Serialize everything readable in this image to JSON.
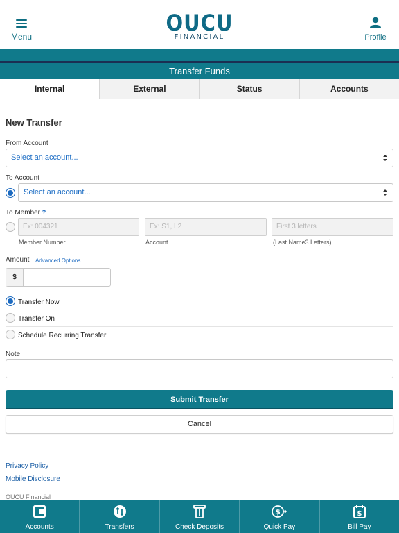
{
  "header": {
    "menu_label": "Menu",
    "logo_main": "OUCU",
    "logo_sub": "FINANCIAL",
    "profile_label": "Profile"
  },
  "page_title": "Transfer Funds",
  "tabs": [
    {
      "label": "Internal",
      "active": true
    },
    {
      "label": "External",
      "active": false
    },
    {
      "label": "Status",
      "active": false
    },
    {
      "label": "Accounts",
      "active": false
    }
  ],
  "form": {
    "section_title": "New Transfer",
    "from_account_label": "From Account",
    "from_account_value": "Select an account...",
    "to_account_label": "To Account",
    "to_account_value": "Select an account...",
    "to_member_label": "To Member",
    "to_member_help": "?",
    "member_number_placeholder": "Ex: 004321",
    "member_number_label": "Member Number",
    "account_placeholder": "Ex: S1, L2",
    "account_label": "Account",
    "last_name_placeholder": "First  3  letters",
    "last_name_label": "(Last Name3  Letters)",
    "amount_label": "Amount",
    "advanced_options": "Advanced Options",
    "currency_symbol": "$",
    "timing_options": [
      {
        "label": "Transfer Now",
        "selected": true
      },
      {
        "label": "Transfer On",
        "selected": false
      },
      {
        "label": "Schedule Recurring Transfer",
        "selected": false
      }
    ],
    "note_label": "Note",
    "submit_label": "Submit Transfer",
    "cancel_label": "Cancel"
  },
  "footer": {
    "privacy_policy": "Privacy Policy",
    "mobile_disclosure": "Mobile Disclosure",
    "company": "OUCU Financial"
  },
  "bottom_nav": [
    {
      "label": "Accounts",
      "icon": "wallet-icon"
    },
    {
      "label": "Transfers",
      "icon": "transfer-arrows-icon"
    },
    {
      "label": "Check Deposits",
      "icon": "check-deposit-icon"
    },
    {
      "label": "Quick Pay",
      "icon": "dollar-send-icon"
    },
    {
      "label": "Bill Pay",
      "icon": "bill-calendar-icon"
    }
  ],
  "colors": {
    "brand_teal": "#107a8b",
    "navy": "#1b2f52",
    "link_blue": "#1c6ac0"
  }
}
